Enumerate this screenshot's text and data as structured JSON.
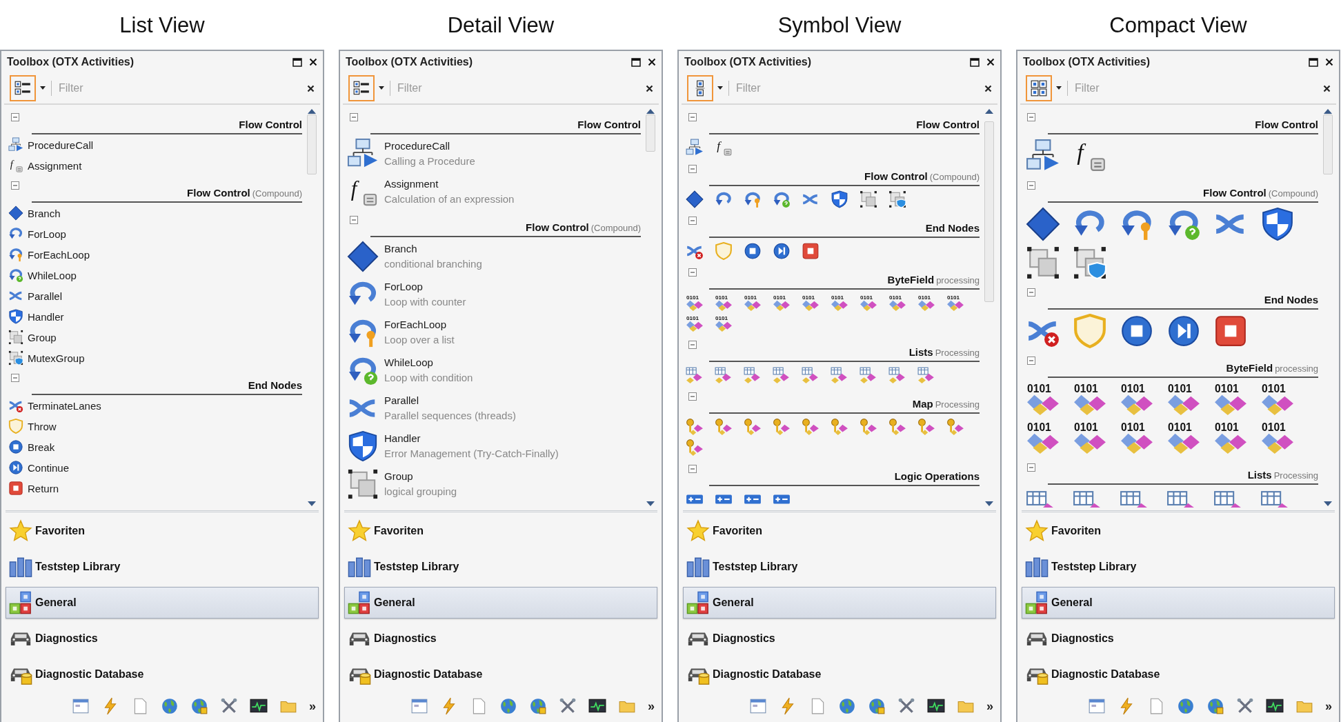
{
  "views": [
    {
      "heading": "List View",
      "kind": "list",
      "title": "Toolbox (OTX Activities)",
      "filter": {
        "placeholder": "Filter"
      },
      "groups": [
        {
          "title": "Flow Control",
          "expanded": true,
          "items": [
            {
              "kind": "procedure",
              "name": "ProcedureCall"
            },
            {
              "kind": "function",
              "glyph": "f",
              "name": "Assignment"
            }
          ]
        },
        {
          "title": "Flow Control",
          "subtitle": "(Compound)",
          "expanded": true,
          "items": [
            {
              "kind": "branch",
              "name": "Branch"
            },
            {
              "kind": "loop",
              "name": "ForLoop"
            },
            {
              "kind": "loop-key",
              "name": "ForEachLoop"
            },
            {
              "kind": "loop-question",
              "name": "WhileLoop"
            },
            {
              "kind": "parallel",
              "name": "Parallel"
            },
            {
              "kind": "handler",
              "name": "Handler"
            },
            {
              "kind": "group",
              "name": "Group"
            },
            {
              "kind": "mutex",
              "name": "MutexGroup"
            }
          ]
        },
        {
          "title": "End Nodes",
          "expanded": true,
          "items": [
            {
              "kind": "terminate",
              "name": "TerminateLanes"
            },
            {
              "kind": "throw",
              "name": "Throw"
            },
            {
              "kind": "break",
              "name": "Break"
            },
            {
              "kind": "continue",
              "name": "Continue"
            },
            {
              "kind": "return",
              "name": "Return"
            }
          ]
        }
      ],
      "categories": [
        {
          "kind": "star",
          "label": "Favoriten",
          "selected": false
        },
        {
          "kind": "books",
          "label": "Teststep Library",
          "selected": false
        },
        {
          "kind": "blocks",
          "label": "General",
          "selected": true
        },
        {
          "kind": "car",
          "label": "Diagnostics",
          "selected": false
        },
        {
          "kind": "car-db",
          "label": "Diagnostic Database",
          "selected": false
        }
      ],
      "tools": [
        {
          "kind": "window"
        },
        {
          "kind": "lightning"
        },
        {
          "kind": "page"
        },
        {
          "kind": "globe"
        },
        {
          "kind": "globe-lock"
        },
        {
          "kind": "tools"
        },
        {
          "kind": "monitor"
        },
        {
          "kind": "folder"
        }
      ],
      "overflow": "»"
    },
    {
      "heading": "Detail View",
      "kind": "detail",
      "title": "Toolbox (OTX Activities)",
      "filter": {
        "placeholder": "Filter"
      },
      "groups": [
        {
          "title": "Flow Control",
          "expanded": true,
          "items": [
            {
              "kind": "procedure",
              "name": "ProcedureCall",
              "description": "Calling a Procedure"
            },
            {
              "kind": "function",
              "glyph": "f",
              "name": "Assignment",
              "description": "Calculation of an expression"
            }
          ]
        },
        {
          "title": "Flow Control",
          "subtitle": "(Compound)",
          "expanded": true,
          "items": [
            {
              "kind": "branch",
              "name": "Branch",
              "description": "conditional branching"
            },
            {
              "kind": "loop",
              "name": "ForLoop",
              "description": "Loop with counter"
            },
            {
              "kind": "loop-key",
              "name": "ForEachLoop",
              "description": "Loop over a list"
            },
            {
              "kind": "loop-question",
              "name": "WhileLoop",
              "description": "Loop with condition"
            },
            {
              "kind": "parallel",
              "name": "Parallel",
              "description": "Parallel sequences (threads)"
            },
            {
              "kind": "handler",
              "name": "Handler",
              "description": "Error Management (Try-Catch-Finally)"
            },
            {
              "kind": "group",
              "name": "Group",
              "description": "logical grouping"
            }
          ]
        }
      ],
      "categories": [
        {
          "kind": "star",
          "label": "Favoriten",
          "selected": false
        },
        {
          "kind": "books",
          "label": "Teststep Library",
          "selected": false
        },
        {
          "kind": "blocks",
          "label": "General",
          "selected": true
        },
        {
          "kind": "car",
          "label": "Diagnostics",
          "selected": false
        },
        {
          "kind": "car-db",
          "label": "Diagnostic Database",
          "selected": false
        }
      ],
      "tools": [
        {
          "kind": "window"
        },
        {
          "kind": "lightning"
        },
        {
          "kind": "page"
        },
        {
          "kind": "globe"
        },
        {
          "kind": "globe-lock"
        },
        {
          "kind": "tools"
        },
        {
          "kind": "monitor"
        },
        {
          "kind": "folder"
        }
      ],
      "overflow": "»"
    },
    {
      "heading": "Symbol View",
      "kind": "symbol",
      "title": "Toolbox (OTX Activities)",
      "filter": {
        "placeholder": "Filter"
      },
      "groups": [
        {
          "title": "Flow Control",
          "expanded": true,
          "items": [
            {
              "kind": "procedure"
            },
            {
              "kind": "function",
              "glyph": "f"
            }
          ]
        },
        {
          "title": "Flow Control",
          "subtitle": "(Compound)",
          "expanded": true,
          "items": [
            {
              "kind": "branch"
            },
            {
              "kind": "loop"
            },
            {
              "kind": "loop-key"
            },
            {
              "kind": "loop-question"
            },
            {
              "kind": "parallel"
            },
            {
              "kind": "handler"
            },
            {
              "kind": "group"
            },
            {
              "kind": "mutex"
            }
          ]
        },
        {
          "title": "End Nodes",
          "expanded": true,
          "items": [
            {
              "kind": "terminate"
            },
            {
              "kind": "throw"
            },
            {
              "kind": "break"
            },
            {
              "kind": "continue"
            },
            {
              "kind": "return"
            }
          ]
        },
        {
          "title": "ByteField",
          "subtitle": "processing",
          "expanded": true,
          "items": [
            {
              "kind": "bytefield",
              "label": "0101"
            },
            {
              "kind": "bytefield",
              "label": "0101"
            },
            {
              "kind": "bytefield",
              "label": "0101"
            },
            {
              "kind": "bytefield",
              "label": "0101"
            },
            {
              "kind": "bytefield",
              "label": "0101"
            },
            {
              "kind": "bytefield",
              "label": "0101"
            },
            {
              "kind": "bytefield",
              "label": "0101"
            },
            {
              "kind": "bytefield",
              "label": "0101"
            },
            {
              "kind": "bytefield",
              "label": "0101"
            },
            {
              "kind": "bytefield",
              "label": "0101"
            },
            {
              "kind": "bytefield",
              "label": "0101"
            },
            {
              "kind": "bytefield",
              "label": "0101"
            }
          ]
        },
        {
          "title": "Lists",
          "subtitle": "Processing",
          "expanded": true,
          "items": [
            {
              "kind": "list"
            },
            {
              "kind": "list"
            },
            {
              "kind": "list"
            },
            {
              "kind": "list"
            },
            {
              "kind": "list"
            },
            {
              "kind": "list"
            },
            {
              "kind": "list"
            },
            {
              "kind": "list"
            },
            {
              "kind": "list"
            }
          ]
        },
        {
          "title": "Map",
          "subtitle": "Processing",
          "expanded": true,
          "items": [
            {
              "kind": "map"
            },
            {
              "kind": "map"
            },
            {
              "kind": "map"
            },
            {
              "kind": "map"
            },
            {
              "kind": "map"
            },
            {
              "kind": "map"
            },
            {
              "kind": "map"
            },
            {
              "kind": "map"
            },
            {
              "kind": "map"
            },
            {
              "kind": "map"
            },
            {
              "kind": "map"
            }
          ]
        },
        {
          "title": "Logic Operations",
          "expanded": true,
          "items": [
            {
              "kind": "logic"
            },
            {
              "kind": "logic"
            },
            {
              "kind": "logic"
            },
            {
              "kind": "logic"
            }
          ]
        }
      ],
      "categories": [
        {
          "kind": "star",
          "label": "Favoriten",
          "selected": false
        },
        {
          "kind": "books",
          "label": "Teststep Library",
          "selected": false
        },
        {
          "kind": "blocks",
          "label": "General",
          "selected": true
        },
        {
          "kind": "car",
          "label": "Diagnostics",
          "selected": false
        },
        {
          "kind": "car-db",
          "label": "Diagnostic Database",
          "selected": false
        }
      ],
      "tools": [
        {
          "kind": "window"
        },
        {
          "kind": "lightning"
        },
        {
          "kind": "page"
        },
        {
          "kind": "globe"
        },
        {
          "kind": "globe-lock"
        },
        {
          "kind": "tools"
        },
        {
          "kind": "monitor"
        },
        {
          "kind": "folder"
        }
      ],
      "overflow": "»"
    },
    {
      "heading": "Compact View",
      "kind": "compact",
      "title": "Toolbox (OTX Activities)",
      "filter": {
        "placeholder": "Filter"
      },
      "groups": [
        {
          "title": "Flow Control",
          "expanded": true,
          "items": [
            {
              "kind": "procedure"
            },
            {
              "kind": "function",
              "glyph": "f"
            }
          ]
        },
        {
          "title": "Flow Control",
          "subtitle": "(Compound)",
          "expanded": true,
          "items": [
            {
              "kind": "branch"
            },
            {
              "kind": "loop"
            },
            {
              "kind": "loop-key"
            },
            {
              "kind": "loop-question"
            },
            {
              "kind": "parallel"
            },
            {
              "kind": "handler"
            },
            {
              "kind": "group"
            },
            {
              "kind": "mutex"
            }
          ]
        },
        {
          "title": "End Nodes",
          "expanded": true,
          "items": [
            {
              "kind": "terminate"
            },
            {
              "kind": "throw"
            },
            {
              "kind": "break"
            },
            {
              "kind": "continue"
            },
            {
              "kind": "return"
            }
          ]
        },
        {
          "title": "ByteField",
          "subtitle": "processing",
          "expanded": true,
          "items": [
            {
              "kind": "bytefield",
              "label": "0101"
            },
            {
              "kind": "bytefield",
              "label": "0101"
            },
            {
              "kind": "bytefield",
              "label": "0101"
            },
            {
              "kind": "bytefield",
              "label": "0101"
            },
            {
              "kind": "bytefield",
              "label": "0101"
            },
            {
              "kind": "bytefield",
              "label": "0101"
            },
            {
              "kind": "bytefield",
              "label": "0101"
            },
            {
              "kind": "bytefield",
              "label": "0101"
            },
            {
              "kind": "bytefield",
              "label": "0101"
            },
            {
              "kind": "bytefield",
              "label": "0101"
            },
            {
              "kind": "bytefield",
              "label": "0101"
            },
            {
              "kind": "bytefield",
              "label": "0101"
            }
          ]
        },
        {
          "title": "Lists",
          "subtitle": "Processing",
          "expanded": true,
          "items": [
            {
              "kind": "list"
            },
            {
              "kind": "list"
            },
            {
              "kind": "list"
            },
            {
              "kind": "list"
            },
            {
              "kind": "list"
            },
            {
              "kind": "list"
            }
          ]
        }
      ],
      "categories": [
        {
          "kind": "star",
          "label": "Favoriten",
          "selected": false
        },
        {
          "kind": "books",
          "label": "Teststep Library",
          "selected": false
        },
        {
          "kind": "blocks",
          "label": "General",
          "selected": true
        },
        {
          "kind": "car",
          "label": "Diagnostics",
          "selected": false
        },
        {
          "kind": "car-db",
          "label": "Diagnostic Database",
          "selected": false
        }
      ],
      "tools": [
        {
          "kind": "window"
        },
        {
          "kind": "lightning"
        },
        {
          "kind": "page"
        },
        {
          "kind": "globe"
        },
        {
          "kind": "globe-lock"
        },
        {
          "kind": "tools"
        },
        {
          "kind": "monitor"
        },
        {
          "kind": "folder"
        }
      ],
      "overflow": "»"
    }
  ]
}
